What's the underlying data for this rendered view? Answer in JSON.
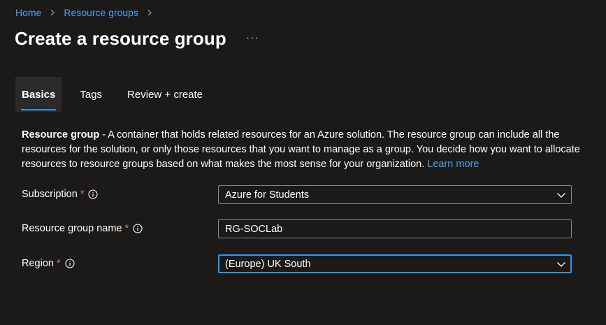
{
  "breadcrumb": {
    "items": [
      {
        "label": "Home"
      },
      {
        "label": "Resource groups"
      }
    ]
  },
  "header": {
    "title": "Create a resource group",
    "more_label": "···"
  },
  "tabs": [
    {
      "label": "Basics",
      "active": true
    },
    {
      "label": "Tags",
      "active": false
    },
    {
      "label": "Review + create",
      "active": false
    }
  ],
  "description": {
    "strong": "Resource group",
    "text": " - A container that holds related resources for an Azure solution. The resource group can include all the resources for the solution, or only those resources that you want to manage as a group. You decide how you want to allocate resources to resource groups based on what makes the most sense for your organization.",
    "learn_more": "Learn more"
  },
  "form": {
    "subscription": {
      "label": "Subscription",
      "required": "*",
      "value": "Azure for Students"
    },
    "resource_group_name": {
      "label": "Resource group name",
      "required": "*",
      "value": "RG-SOCLab"
    },
    "region": {
      "label": "Region",
      "required": "*",
      "value": "(Europe) UK South"
    }
  },
  "colors": {
    "background": "#1b1a19",
    "link": "#4ea1f3",
    "accent": "#2899f5",
    "required": "#f1707b"
  }
}
